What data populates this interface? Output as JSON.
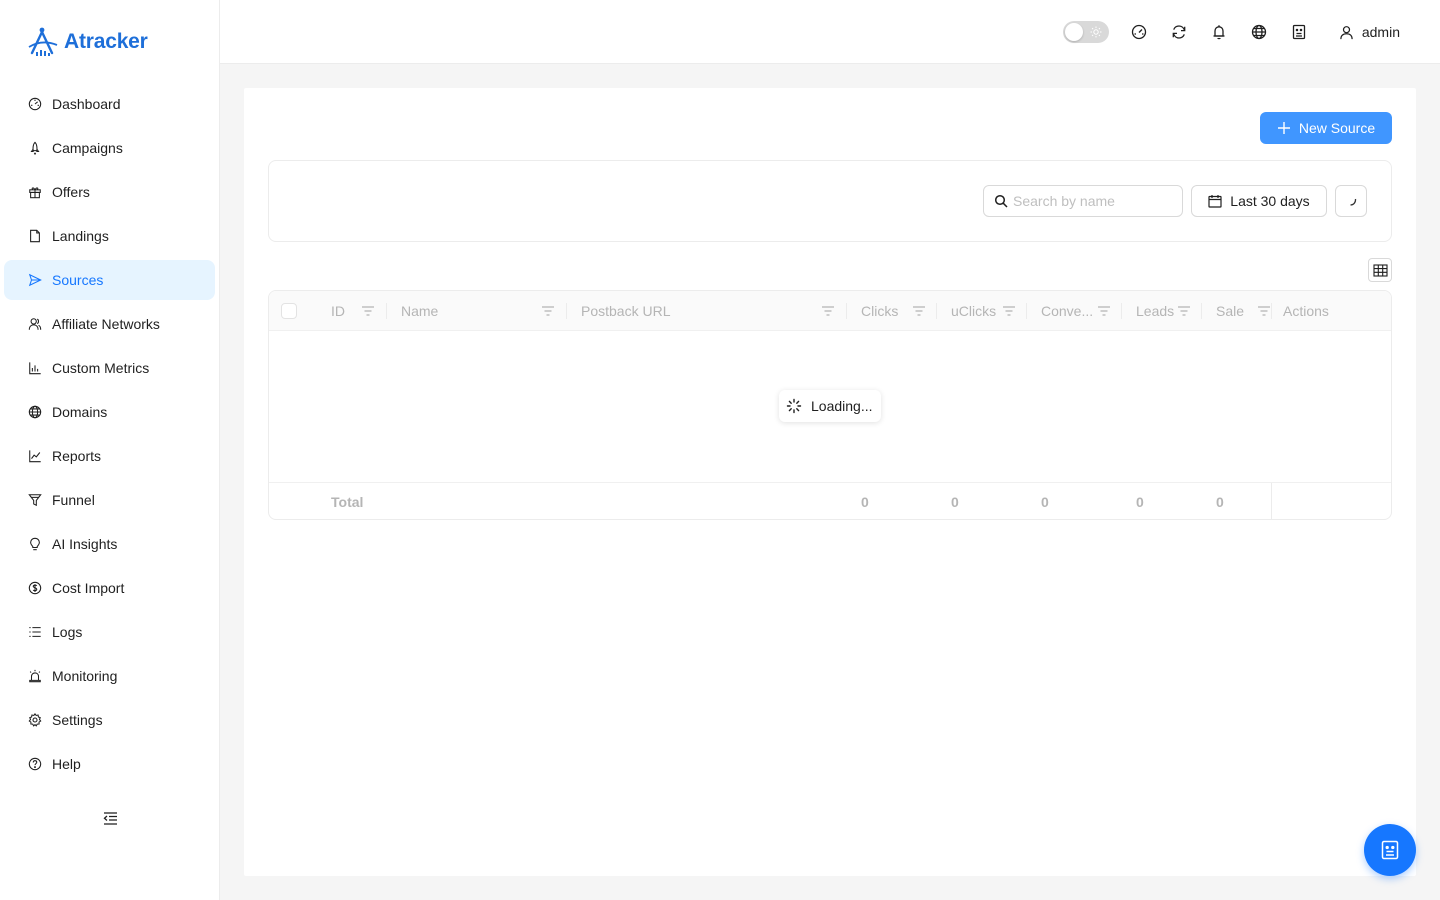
{
  "app": {
    "name": "Atracker",
    "brand_color": "#1e6fd9",
    "accent": "#1677ff"
  },
  "sidebar": {
    "items": [
      {
        "label": "Dashboard",
        "icon": "dashboard-icon",
        "active": false
      },
      {
        "label": "Campaigns",
        "icon": "rocket-icon",
        "active": false
      },
      {
        "label": "Offers",
        "icon": "gift-icon",
        "active": false
      },
      {
        "label": "Landings",
        "icon": "file-icon",
        "active": false
      },
      {
        "label": "Sources",
        "icon": "send-icon",
        "active": true
      },
      {
        "label": "Affiliate Networks",
        "icon": "team-icon",
        "active": false
      },
      {
        "label": "Custom Metrics",
        "icon": "bar-chart-icon",
        "active": false
      },
      {
        "label": "Domains",
        "icon": "globe-icon",
        "active": false
      },
      {
        "label": "Reports",
        "icon": "line-chart-icon",
        "active": false
      },
      {
        "label": "Funnel",
        "icon": "funnel-icon",
        "active": false
      },
      {
        "label": "AI Insights",
        "icon": "bulb-icon",
        "active": false
      },
      {
        "label": "Cost Import",
        "icon": "dollar-icon",
        "active": false
      },
      {
        "label": "Logs",
        "icon": "list-icon",
        "active": false
      },
      {
        "label": "Monitoring",
        "icon": "alert-icon",
        "active": false
      },
      {
        "label": "Settings",
        "icon": "gear-icon",
        "active": false
      },
      {
        "label": "Help",
        "icon": "question-icon",
        "active": false
      }
    ]
  },
  "header": {
    "user": "admin"
  },
  "toolbar": {
    "new_source_label": "New Source",
    "search_placeholder": "Search by name",
    "date_range": "Last 30 days"
  },
  "table": {
    "columns": [
      "ID",
      "Name",
      "Postback URL",
      "Clicks",
      "uClicks",
      "Conve...",
      "Leads",
      "Sale",
      "Actions"
    ],
    "loading_text": "Loading...",
    "footer": {
      "label": "Total",
      "clicks": "0",
      "uclicks": "0",
      "conversions": "0",
      "leads": "0",
      "sale": "0"
    }
  }
}
